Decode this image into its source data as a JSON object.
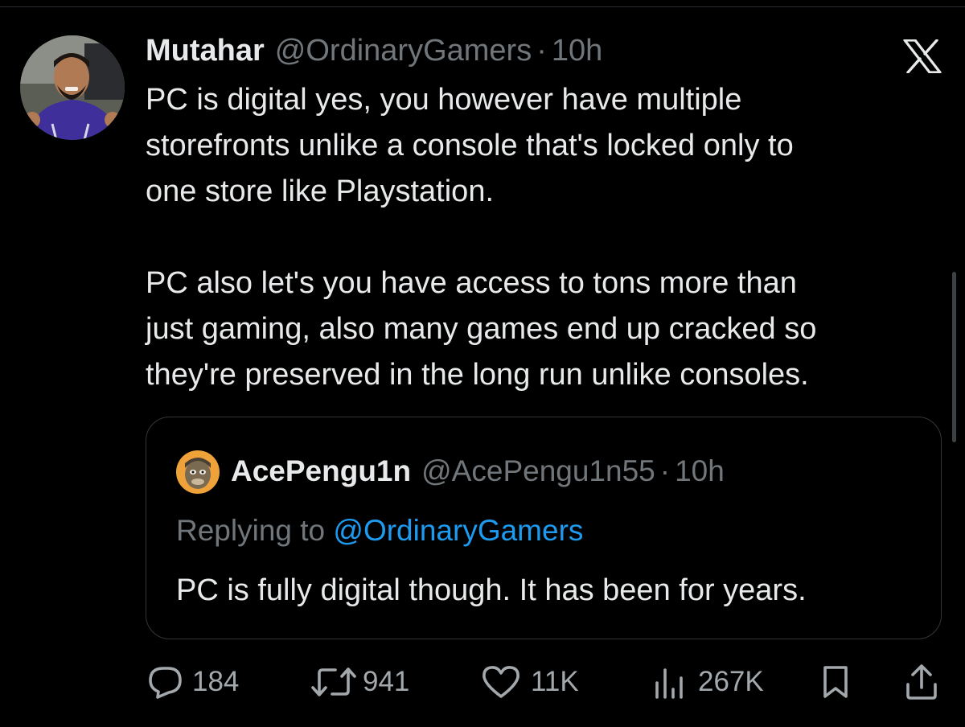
{
  "tweet": {
    "author_name": "Mutahar",
    "author_handle": "@OrdinaryGamers",
    "separator": "·",
    "time": "10h",
    "paragraphs": [
      "PC is digital yes, you however have multiple\nstorefronts unlike a console that's locked only to\none store like Playstation.",
      "PC also let's you have access to tons more than\njust gaming, also many games end up cracked so\nthey're preserved in the long run unlike consoles."
    ]
  },
  "quoted_tweet": {
    "author_name": "AcePengu1n",
    "author_handle": "@AcePengu1n55",
    "separator": "·",
    "time": "10h",
    "replying_prefix": "Replying to ",
    "replying_handle": "@OrdinaryGamers",
    "text": "PC is fully digital though. It has been for years."
  },
  "actions": {
    "replies": "184",
    "reposts": "941",
    "likes": "11K",
    "views": "267K"
  },
  "icons": {
    "logo": "x-logo-icon",
    "reply": "reply-icon",
    "repost": "repost-icon",
    "like": "heart-icon",
    "views": "views-icon",
    "bookmark": "bookmark-icon",
    "share": "share-icon"
  },
  "colors": {
    "background": "#000000",
    "text": "#e7e9ea",
    "muted": "#71767b",
    "link": "#1d9bf0",
    "border": "#333639"
  }
}
